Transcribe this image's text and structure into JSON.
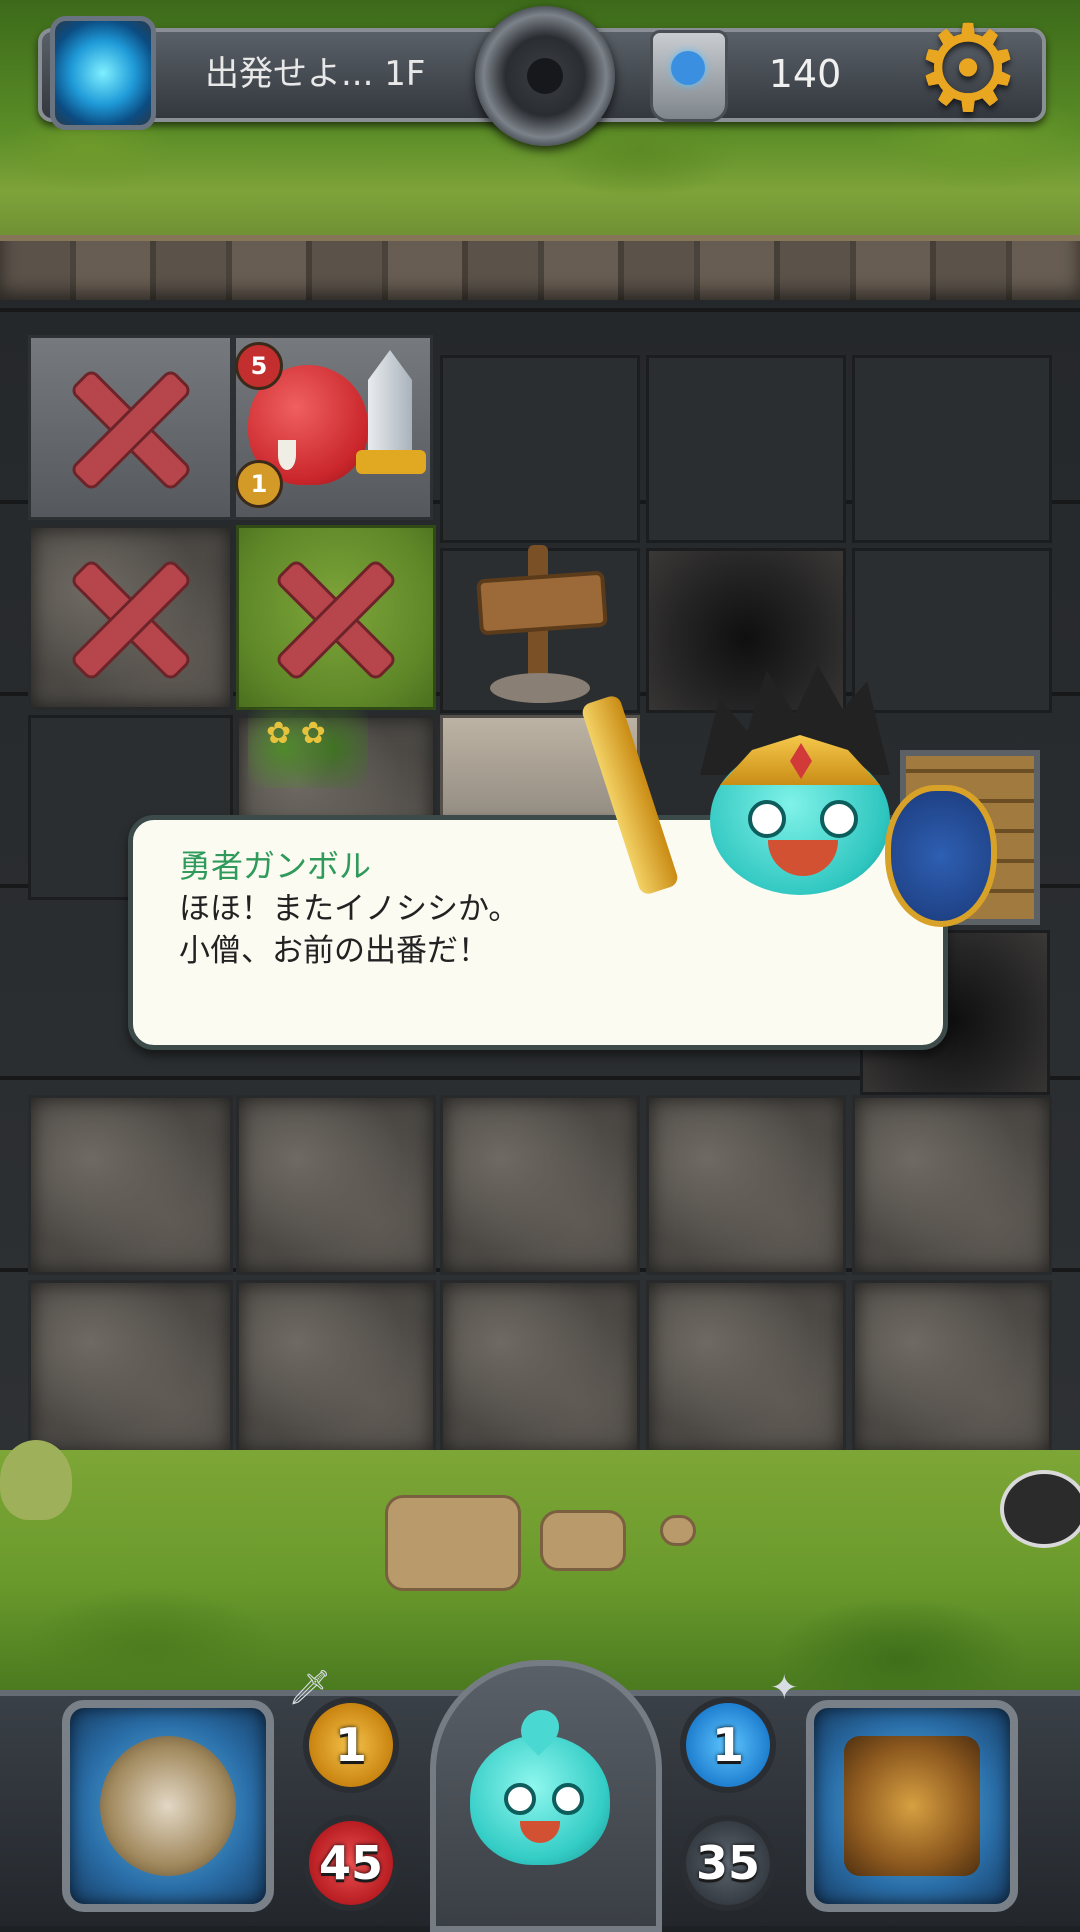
{
  "hud": {
    "floor_label": "出発せよ... 1F",
    "currency_count": "140",
    "icons": {
      "portal": "portal-icon",
      "medallion": "bomb-medallion-icon",
      "stone": "rune-stone-icon",
      "settings": "gear-icon"
    }
  },
  "board": {
    "enemy": {
      "name_icon": "boar-warrior-icon",
      "attack": "5",
      "hp": "1"
    }
  },
  "dialog": {
    "speaker": "勇者ガンボル",
    "lines": [
      "ほほ！またイノシシか。",
      "小僧、お前の出番だ！"
    ]
  },
  "controls": {
    "player_attack": "1",
    "player_hp": "45",
    "player_shield": "1",
    "player_mana": "35"
  },
  "colors": {
    "speaker": "#2f9a5a",
    "accent_gold": "#e9a721",
    "x_mark": "#b7464c"
  }
}
